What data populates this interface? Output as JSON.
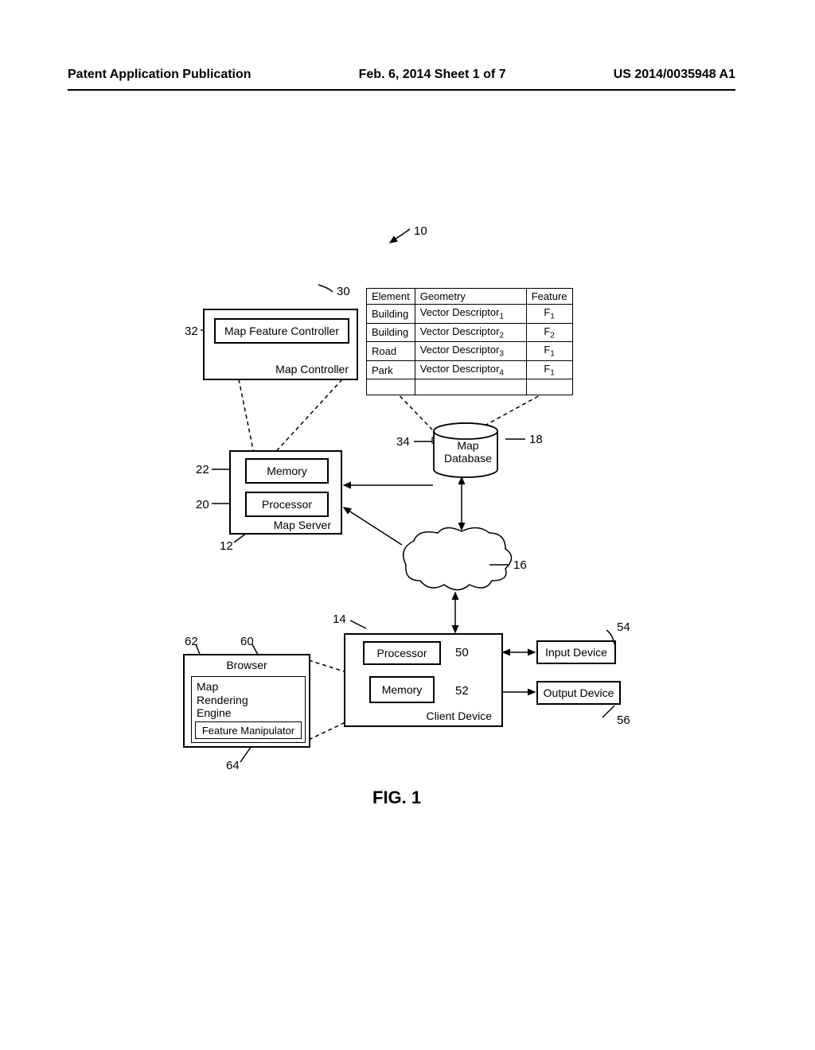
{
  "header": {
    "left": "Patent Application Publication",
    "center": "Feb. 6, 2014  Sheet 1 of 7",
    "right": "US 2014/0035948 A1"
  },
  "refs": {
    "r10": "10",
    "r30": "30",
    "r32": "32",
    "r34": "34",
    "r18": "18",
    "r22": "22",
    "r20": "20",
    "r12": "12",
    "r16": "16",
    "r14": "14",
    "r50": "50",
    "r52": "52",
    "r54": "54",
    "r56": "56",
    "r60": "60",
    "r62": "62",
    "r64": "64"
  },
  "labels": {
    "map_feature_controller": "Map Feature Controller",
    "map_controller": "Map Controller",
    "memory": "Memory",
    "processor": "Processor",
    "map_server": "Map Server",
    "map_database": "Map\nDatabase",
    "client_device": "Client Device",
    "browser": "Browser",
    "map_rendering_engine": "Map\nRendering\nEngine",
    "feature_manipulator": "Feature Manipulator",
    "input_device": "Input Device",
    "output_device": "Output Device"
  },
  "table": {
    "headers": [
      "Element",
      "Geometry",
      "Feature"
    ],
    "rows": [
      [
        "Building",
        "Vector Descriptor",
        "1",
        "F",
        "1"
      ],
      [
        "Building",
        "Vector Descriptor",
        "2",
        "F",
        "2"
      ],
      [
        "Road",
        "Vector Descriptor",
        "3",
        "F",
        "1"
      ],
      [
        "Park",
        "Vector Descriptor",
        "4",
        "F",
        "1"
      ]
    ]
  },
  "caption": "FIG. 1"
}
